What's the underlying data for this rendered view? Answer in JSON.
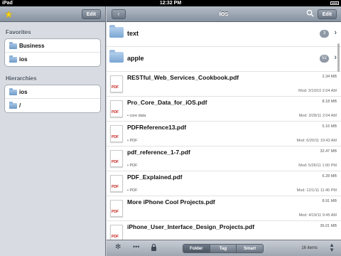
{
  "status": {
    "device": "iPad",
    "time": "12:32 PM"
  },
  "left": {
    "edit_label": "Edit",
    "favorites_title": "Favorites",
    "favorites": [
      {
        "label": "Business"
      },
      {
        "label": "ios"
      }
    ],
    "hierarchies_title": "Hierarchies",
    "hierarchies": [
      {
        "label": "ios"
      },
      {
        "label": "/"
      }
    ]
  },
  "right": {
    "title": "ios",
    "edit_label": "Edit",
    "back_icon": "back-arrow-icon",
    "folders": [
      {
        "name": "text",
        "count": "3"
      },
      {
        "name": "apple",
        "count": "52"
      }
    ],
    "files": [
      {
        "name": "RESTful_Web_Services_Cookbook.pdf",
        "size": "2.34 MB",
        "tag": "",
        "mod": "Mod: 3/10/10 2:04 AM"
      },
      {
        "name": "Pro_Core_Data_for_iOS.pdf",
        "size": "8.18 MB",
        "tag": "• core data",
        "mod": "Mod: 3/28/11 2:04 AM"
      },
      {
        "name": "PDFReference13.pdf",
        "size": "5.16 MB",
        "tag": "• PDF",
        "mod": "Mod: 6/20/11 10:43 AM"
      },
      {
        "name": "pdf_reference_1-7.pdf",
        "size": "32.47 MB",
        "tag": "• PDF",
        "mod": "Mod: 5/26/11 1:00 PM"
      },
      {
        "name": "PDF_Explained.pdf",
        "size": "6.28 MB",
        "tag": "• PDF",
        "mod": "Mod: 12/1/11 11:45 PM"
      },
      {
        "name": "More iPhone Cool Projects.pdf",
        "size": "8.91 MB",
        "tag": "",
        "mod": "Mod: 4/19/11 9:45 AM"
      },
      {
        "name": "iPhone_User_Interface_Design_Projects.pdf",
        "size": "36.01 MB",
        "tag": "",
        "mod": ""
      }
    ],
    "pdf_badge": "PDF"
  },
  "bottom": {
    "segments": [
      "Folder",
      "Tag",
      "Smart"
    ],
    "active_segment": "Folder",
    "items_count": "16 items"
  }
}
